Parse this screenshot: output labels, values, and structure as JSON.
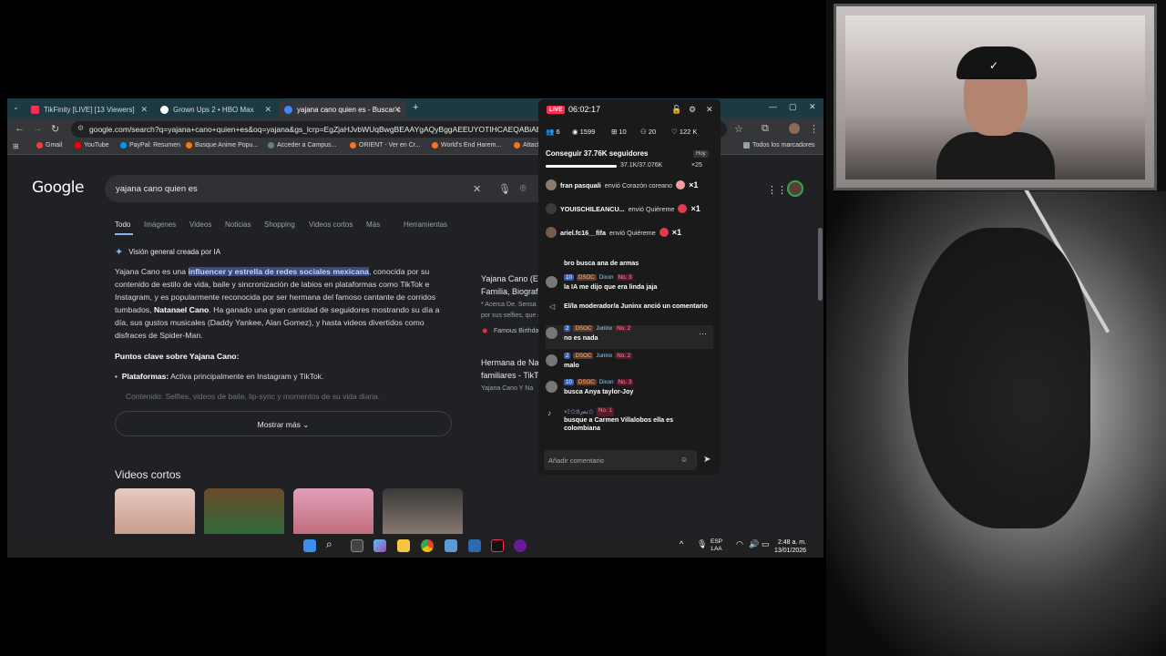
{
  "browser": {
    "tabs": [
      {
        "label": "TikFinity [LIVE] [13 Viewers]",
        "color": "#fe2c55"
      },
      {
        "label": "Grown Ups 2 • HBO Max",
        "color": "#ffffff"
      },
      {
        "label": "yajana cano quien es - Buscar c",
        "color": "#4285f4"
      }
    ],
    "url": "google.com/search?q=yajana+cano+quien+es&oq=yajana&gs_lcrp=EgZjaHJvbWUqBwgBEAAYgAQyBggAEEUYOTIHCAEQABiABDIHCAIQABiABDIH",
    "bookmarks": [
      {
        "label": "Gmail",
        "color": "#ea4335"
      },
      {
        "label": "YouTube",
        "color": "#ff0000"
      },
      {
        "label": "PayPal: Resumen",
        "color": "#009cde"
      },
      {
        "label": "Busque Anime Popu...",
        "color": "#f57c00"
      },
      {
        "label": "Acceder a Campus...",
        "color": "#607d8b"
      },
      {
        "label": "ORIENT - Ver en Cr...",
        "color": "#f47521"
      },
      {
        "label": "World's End Harem...",
        "color": "#f47521"
      },
      {
        "label": "Attack on Titan...",
        "color": "#f47521"
      },
      {
        "label": "Todos los marcadores",
        "color": "#9aa0a6"
      }
    ]
  },
  "google": {
    "logo": "Google",
    "query": "yajana cano quien es",
    "tabs": [
      "Todo",
      "Imágenes",
      "Videos",
      "Noticias",
      "Shopping",
      "Videos cortos",
      "Más",
      "Herramientas"
    ],
    "ai_header": "Visión general creada por IA",
    "ai_p1_a": "Yajana Cano es una ",
    "ai_p1_hl": "influencer y estrella de redes sociales mexicana",
    "ai_p1_b": ", conocida por su contenido de estilo de vida, baile y sincronización de labios en plataformas como TikTok e Instagram, y es popularmente reconocida por ser hermana del famoso cantante de corridos tumbados, ",
    "ai_p1_bold": "Natanael Cano",
    "ai_p1_c": ". Ha ganado una gran cantidad de seguidores mostrando su día a día, sus gustos musicales (Daddy Yankee, Alan Gomez), y hasta videos divertidos como disfraces de Spider-Man.",
    "puntos": "Puntos clave sobre Yajana Cano:",
    "plat_label": "Plataformas:",
    "plat_text": " Activa principalmente en Instagram y TikTok.",
    "contenido": "Contenido: Selfies, videos de baile, lip-sync y momentos de su vida diaria.",
    "mostrar_mas": "Mostrar más",
    "videos_cortos": "Videos cortos",
    "side1_title": "Yajana Cano (Es",
    "side1_sub": "Familia, Biografía",
    "side1_snip": "* Acerca De. Sensa",
    "side1_snip2": "por sus selfies, que compar",
    "side1_source": "Famous Birthdays",
    "side2_title": "Hermana de Nata",
    "side2_sub": "familiares - TikTok",
    "side2_snip": "Yajana Cano Y Na"
  },
  "taskbar": {
    "lang1": "ESP",
    "lang2": "LAA",
    "time": "2:48 a. m.",
    "date": "13/01/2026"
  },
  "tikfinity": {
    "live": "LIVE",
    "timer": "06:02:17",
    "stats": [
      "6",
      "1599",
      "10",
      "20",
      "122 K"
    ],
    "goal_text": "Conseguir 37.76K seguidores",
    "goal_hoy": "Hoy",
    "goal_count": "37.1K/37.076K",
    "goal_mult": "×25",
    "goal_progress": 1.0,
    "gifts": [
      {
        "user": "fran pasquali",
        "text": "envió Corazón coreano",
        "mult": "×1"
      },
      {
        "user": "YOUISCHILEANCU...",
        "text": "envió Quiéreme",
        "mult": "×1"
      },
      {
        "user": "ariel.fc16__fifa",
        "text": "envió Quiéreme",
        "mult": "×1"
      }
    ],
    "chat": [
      {
        "lvl": "",
        "dsoc": "",
        "user": "",
        "no": "",
        "text": "bro busca ana de armas"
      },
      {
        "lvl": "10",
        "dsoc": "DSOC",
        "user": "Dixon",
        "no": "No. 3",
        "text": "la IA me dijo que era linda jaja"
      },
      {
        "lvl": "",
        "dsoc": "",
        "user": "",
        "no": "",
        "text": "El/la moderador/a Juninx anció un comentario"
      },
      {
        "lvl": "2",
        "dsoc": "DSOC",
        "user": "Juninx",
        "no": "No. 2",
        "text": "no es nada"
      },
      {
        "lvl": "2",
        "dsoc": "DSOC",
        "user": "Juninx",
        "no": "No. 2",
        "text": "malo"
      },
      {
        "lvl": "10",
        "dsoc": "DSOC",
        "user": "Dixon",
        "no": "No. 3",
        "text": "busca Anya taylor-Joy"
      },
      {
        "lvl": "",
        "dsoc": "",
        "user": "×ﾐ☆ℬ𝒿𝒶𝓈☆",
        "no": "No. 1",
        "text": "busque a Carmen Villalobos ella es colombiana"
      }
    ],
    "comment_placeholder": "Añadir comentario"
  }
}
